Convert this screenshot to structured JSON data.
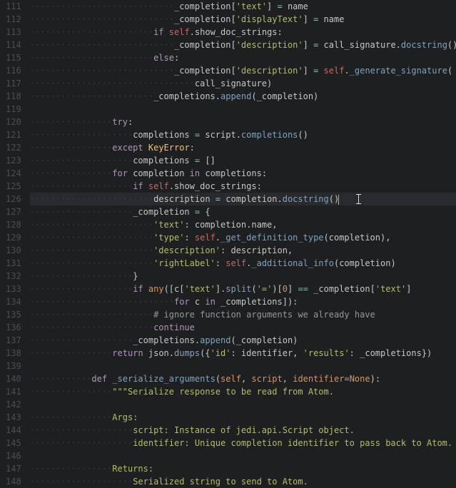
{
  "editor": {
    "first_line_number": 111,
    "last_line_number": 148,
    "current_line": 126,
    "cursor_col_text": "                description = completion.docstring()",
    "mouse_ibeam_line": 126,
    "lines": [
      {
        "n": 111,
        "indent": 28,
        "tokens": [
          [
            "var",
            "_completion["
          ],
          [
            "str",
            "'text'"
          ],
          [
            "var",
            "] "
          ],
          [
            "op",
            "="
          ],
          [
            "var",
            " name"
          ]
        ]
      },
      {
        "n": 112,
        "indent": 28,
        "tokens": [
          [
            "var",
            "_completion["
          ],
          [
            "str",
            "'displayText'"
          ],
          [
            "var",
            "] "
          ],
          [
            "op",
            "="
          ],
          [
            "var",
            " name"
          ]
        ]
      },
      {
        "n": 113,
        "indent": 24,
        "tokens": [
          [
            "kw",
            "if"
          ],
          [
            "var",
            " "
          ],
          [
            "self",
            "self"
          ],
          [
            "var",
            "."
          ],
          [
            "var",
            "show_doc_strings:"
          ]
        ]
      },
      {
        "n": 114,
        "indent": 28,
        "tokens": [
          [
            "var",
            "_completion["
          ],
          [
            "str",
            "'description'"
          ],
          [
            "var",
            "] "
          ],
          [
            "op",
            "="
          ],
          [
            "var",
            " call_signature."
          ],
          [
            "fn",
            "docstring"
          ],
          [
            "var",
            "()"
          ]
        ]
      },
      {
        "n": 115,
        "indent": 24,
        "tokens": [
          [
            "kw",
            "else"
          ],
          [
            "var",
            ":"
          ]
        ]
      },
      {
        "n": 116,
        "indent": 28,
        "tokens": [
          [
            "var",
            "_completion["
          ],
          [
            "str",
            "'description'"
          ],
          [
            "var",
            "] "
          ],
          [
            "op",
            "="
          ],
          [
            "var",
            " "
          ],
          [
            "self",
            "self"
          ],
          [
            "var",
            "."
          ],
          [
            "fn",
            "_generate_signature"
          ],
          [
            "var",
            "("
          ]
        ]
      },
      {
        "n": 117,
        "indent": 32,
        "tokens": [
          [
            "var",
            "call_signature)"
          ]
        ]
      },
      {
        "n": 118,
        "indent": 24,
        "tokens": [
          [
            "var",
            "_completions."
          ],
          [
            "fn",
            "append"
          ],
          [
            "var",
            "(_completion)"
          ]
        ]
      },
      {
        "n": 119,
        "indent": 0,
        "tokens": []
      },
      {
        "n": 120,
        "indent": 16,
        "tokens": [
          [
            "kw",
            "try"
          ],
          [
            "var",
            ":"
          ]
        ]
      },
      {
        "n": 121,
        "indent": 20,
        "tokens": [
          [
            "var",
            "completions "
          ],
          [
            "op",
            "="
          ],
          [
            "var",
            " script."
          ],
          [
            "fn",
            "completions"
          ],
          [
            "var",
            "()"
          ]
        ]
      },
      {
        "n": 122,
        "indent": 16,
        "tokens": [
          [
            "kw",
            "except"
          ],
          [
            "var",
            " "
          ],
          [
            "type",
            "KeyError"
          ],
          [
            "var",
            ":"
          ]
        ]
      },
      {
        "n": 123,
        "indent": 20,
        "tokens": [
          [
            "var",
            "completions "
          ],
          [
            "op",
            "="
          ],
          [
            "var",
            " []"
          ]
        ]
      },
      {
        "n": 124,
        "indent": 16,
        "tokens": [
          [
            "kw",
            "for"
          ],
          [
            "var",
            " completion "
          ],
          [
            "kw",
            "in"
          ],
          [
            "var",
            " completions:"
          ]
        ]
      },
      {
        "n": 125,
        "indent": 20,
        "tokens": [
          [
            "kw",
            "if"
          ],
          [
            "var",
            " "
          ],
          [
            "self",
            "self"
          ],
          [
            "var",
            ".show_doc_strings:"
          ]
        ]
      },
      {
        "n": 126,
        "indent": 24,
        "tokens": [
          [
            "var",
            "description "
          ],
          [
            "op",
            "="
          ],
          [
            "var",
            " completion."
          ],
          [
            "fn",
            "docstring"
          ],
          [
            "var",
            "()"
          ]
        ]
      },
      {
        "n": 127,
        "indent": 20,
        "tokens": [
          [
            "var",
            "_completion "
          ],
          [
            "op",
            "="
          ],
          [
            "var",
            " {"
          ]
        ]
      },
      {
        "n": 128,
        "indent": 24,
        "tokens": [
          [
            "str",
            "'text'"
          ],
          [
            "var",
            ": completion.name,"
          ]
        ]
      },
      {
        "n": 129,
        "indent": 24,
        "tokens": [
          [
            "str",
            "'type'"
          ],
          [
            "var",
            ": "
          ],
          [
            "self",
            "self"
          ],
          [
            "var",
            "."
          ],
          [
            "fn",
            "_get_definition_type"
          ],
          [
            "var",
            "(completion),"
          ]
        ]
      },
      {
        "n": 130,
        "indent": 24,
        "tokens": [
          [
            "str",
            "'description'"
          ],
          [
            "var",
            ": description,"
          ]
        ]
      },
      {
        "n": 131,
        "indent": 24,
        "tokens": [
          [
            "str",
            "'rightLabel'"
          ],
          [
            "var",
            ": "
          ],
          [
            "self",
            "self"
          ],
          [
            "var",
            "."
          ],
          [
            "fn",
            "_additional_info"
          ],
          [
            "var",
            "(completion)"
          ]
        ]
      },
      {
        "n": 132,
        "indent": 20,
        "tokens": [
          [
            "var",
            "}"
          ]
        ]
      },
      {
        "n": 133,
        "indent": 20,
        "tokens": [
          [
            "kw",
            "if"
          ],
          [
            "var",
            " "
          ],
          [
            "builtin",
            "any"
          ],
          [
            "var",
            "([c["
          ],
          [
            "str",
            "'text'"
          ],
          [
            "var",
            "]."
          ],
          [
            "fn",
            "split"
          ],
          [
            "var",
            "("
          ],
          [
            "str",
            "'='"
          ],
          [
            "var",
            ")["
          ],
          [
            "num",
            "0"
          ],
          [
            "var",
            "] "
          ],
          [
            "op",
            "=="
          ],
          [
            "var",
            " _completion["
          ],
          [
            "str",
            "'text'"
          ],
          [
            "var",
            "]"
          ]
        ]
      },
      {
        "n": 134,
        "indent": 28,
        "tokens": [
          [
            "kw",
            "for"
          ],
          [
            "var",
            " c "
          ],
          [
            "kw",
            "in"
          ],
          [
            "var",
            " _completions]):"
          ]
        ]
      },
      {
        "n": 135,
        "indent": 24,
        "tokens": [
          [
            "comment",
            "# ignore function arguments we already have"
          ]
        ]
      },
      {
        "n": 136,
        "indent": 24,
        "tokens": [
          [
            "kw",
            "continue"
          ]
        ]
      },
      {
        "n": 137,
        "indent": 20,
        "tokens": [
          [
            "var",
            "_completions."
          ],
          [
            "fn",
            "append"
          ],
          [
            "var",
            "(_completion)"
          ]
        ]
      },
      {
        "n": 138,
        "indent": 16,
        "tokens": [
          [
            "kw",
            "return"
          ],
          [
            "var",
            " json."
          ],
          [
            "fn",
            "dumps"
          ],
          [
            "var",
            "({"
          ],
          [
            "str",
            "'id'"
          ],
          [
            "var",
            ": identifier, "
          ],
          [
            "str",
            "'results'"
          ],
          [
            "var",
            ": _completions})"
          ]
        ]
      },
      {
        "n": 139,
        "indent": 0,
        "tokens": []
      },
      {
        "n": 140,
        "indent": 12,
        "tokens": [
          [
            "kw",
            "def"
          ],
          [
            "var",
            " "
          ],
          [
            "fn",
            "_serialize_arguments"
          ],
          [
            "var",
            "("
          ],
          [
            "param",
            "self"
          ],
          [
            "var",
            ", "
          ],
          [
            "param",
            "script"
          ],
          [
            "var",
            ", "
          ],
          [
            "param",
            "identifier"
          ],
          [
            "op",
            "="
          ],
          [
            "builtin",
            "None"
          ],
          [
            "var",
            "):"
          ]
        ]
      },
      {
        "n": 141,
        "indent": 16,
        "tokens": [
          [
            "str",
            "\"\"\"Serialize response to be read from Atom."
          ]
        ]
      },
      {
        "n": 142,
        "indent": 0,
        "tokens": []
      },
      {
        "n": 143,
        "indent": 16,
        "tokens": [
          [
            "str",
            "Args:"
          ]
        ]
      },
      {
        "n": 144,
        "indent": 20,
        "tokens": [
          [
            "str",
            "script: Instance of jedi.api.Script object."
          ]
        ]
      },
      {
        "n": 145,
        "indent": 20,
        "tokens": [
          [
            "str",
            "identifier: Unique completion identifier to pass back to Atom."
          ]
        ]
      },
      {
        "n": 146,
        "indent": 0,
        "tokens": []
      },
      {
        "n": 147,
        "indent": 16,
        "tokens": [
          [
            "str",
            "Returns:"
          ]
        ]
      },
      {
        "n": 148,
        "indent": 20,
        "tokens": [
          [
            "str",
            "Serialized string to send to Atom."
          ]
        ]
      }
    ]
  }
}
